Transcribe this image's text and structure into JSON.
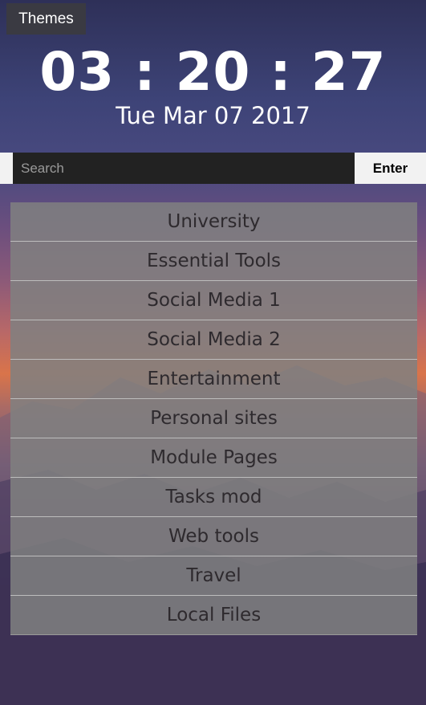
{
  "themes_button": {
    "label": "Themes"
  },
  "clock": {
    "time": "03 : 20 : 27",
    "date": "Tue Mar 07 2017"
  },
  "search": {
    "placeholder": "Search",
    "value": "",
    "enter_label": "Enter"
  },
  "menu": {
    "items": [
      {
        "label": "University"
      },
      {
        "label": "Essential Tools"
      },
      {
        "label": "Social Media 1"
      },
      {
        "label": "Social Media 2"
      },
      {
        "label": "Entertainment"
      },
      {
        "label": "Personal sites"
      },
      {
        "label": "Module Pages"
      },
      {
        "label": "Tasks mod"
      },
      {
        "label": "Web tools"
      },
      {
        "label": "Travel"
      },
      {
        "label": "Local Files"
      }
    ]
  },
  "colors": {
    "menu_item_bg": "#808080",
    "menu_text": "#2e2a2e",
    "search_bg": "#222222",
    "themes_bg": "#3a3a42"
  }
}
